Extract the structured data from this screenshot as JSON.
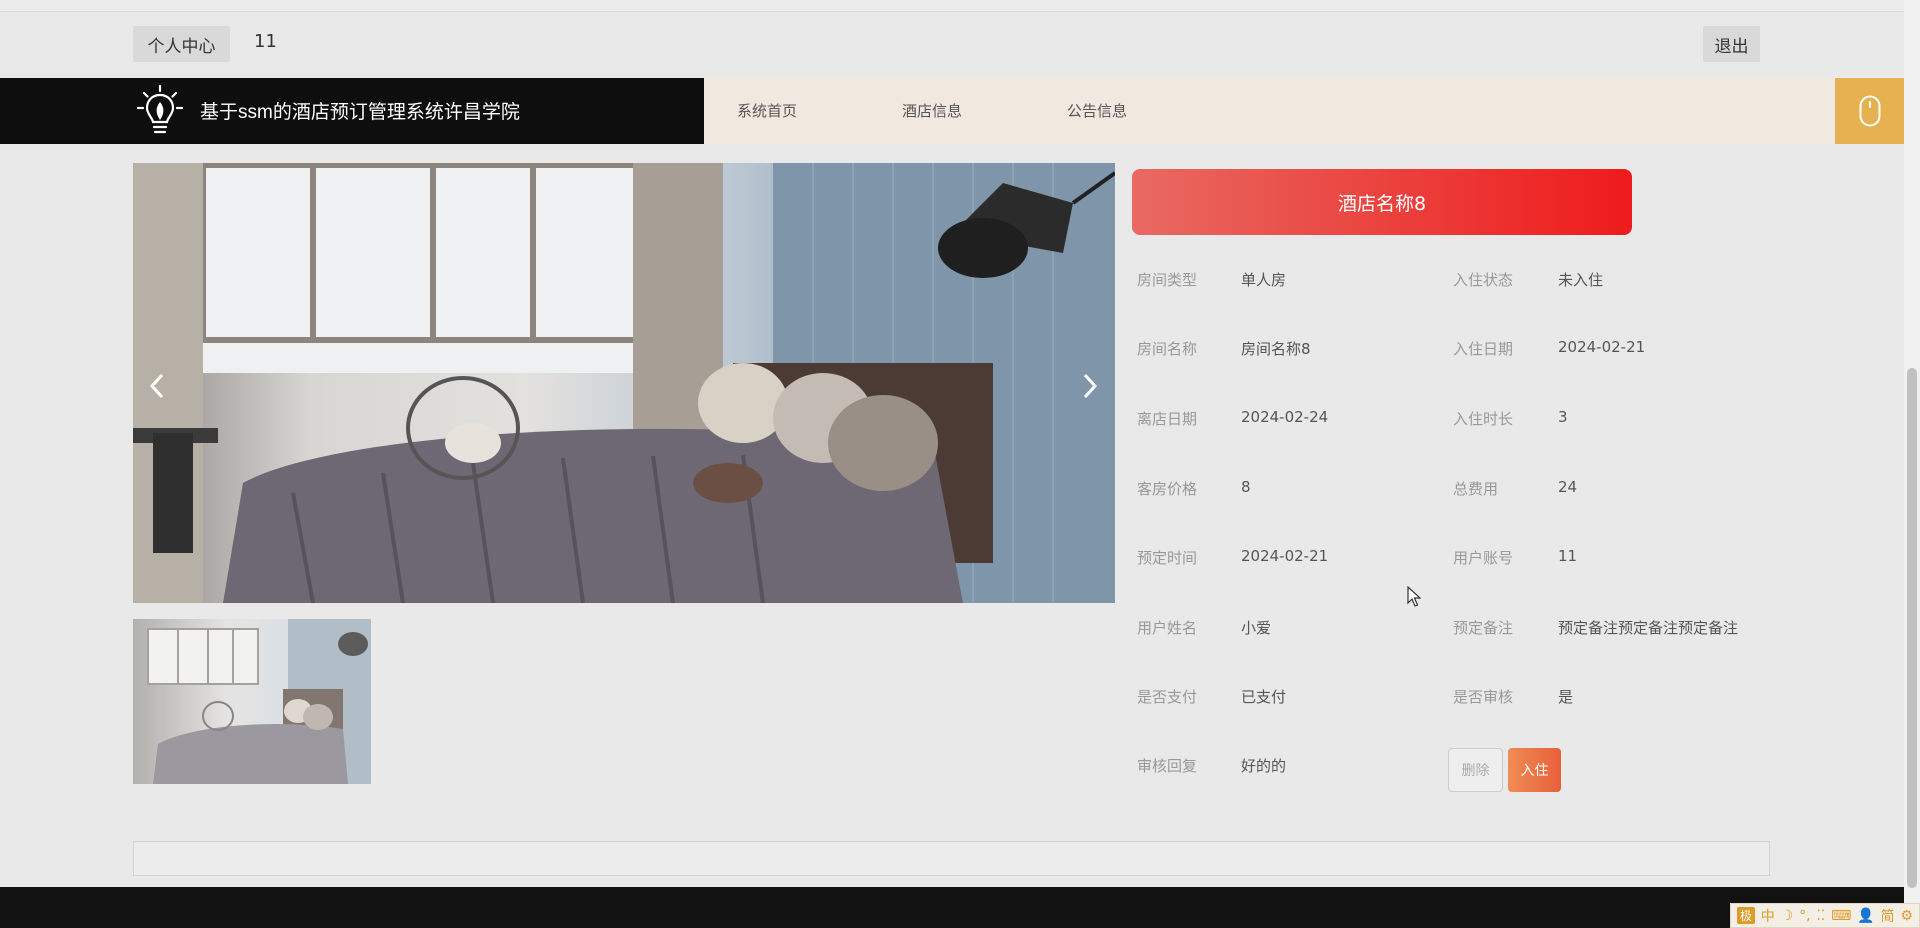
{
  "topbar": {
    "personal_center": "个人中心",
    "user_id": "11",
    "logout": "退出"
  },
  "header": {
    "title": "基于ssm的酒店预订管理系统许昌学院",
    "nav": [
      "系统首页",
      "酒店信息",
      "公告信息"
    ]
  },
  "gallery": {
    "prev_glyph": "‹",
    "next_glyph": "›"
  },
  "detail": {
    "hotel_name": "酒店名称8",
    "fields": [
      {
        "label": "房间类型",
        "value": "单人房"
      },
      {
        "label": "入住状态",
        "value": "未入住"
      },
      {
        "label": "房间名称",
        "value": "房间名称8"
      },
      {
        "label": "入住日期",
        "value": "2024-02-21"
      },
      {
        "label": "离店日期",
        "value": "2024-02-24"
      },
      {
        "label": "入住时长",
        "value": "3"
      },
      {
        "label": "客房价格",
        "value": "8"
      },
      {
        "label": "总费用",
        "value": "24"
      },
      {
        "label": "预定时间",
        "value": "2024-02-21"
      },
      {
        "label": "用户账号",
        "value": "11"
      },
      {
        "label": "用户姓名",
        "value": "小爱"
      },
      {
        "label": "预定备注",
        "value": "预定备注预定备注预定备注"
      },
      {
        "label": "是否支付",
        "value": "已支付"
      },
      {
        "label": "是否审核",
        "value": "是"
      },
      {
        "label": "审核回复",
        "value": "好的的"
      }
    ],
    "delete_label": "删除",
    "checkin_label": "入住"
  },
  "ime": {
    "logo": "极",
    "items": [
      "中",
      "☽",
      "°,",
      "⁚⁚",
      "⌨",
      "👤",
      "简",
      "⚙"
    ]
  },
  "colors": {
    "brand_bg": "#0e0e0e",
    "nav_bg": "#f1e8e0",
    "nav_accent": "#e6b150",
    "title_gradient_start": "#e86a62",
    "title_gradient_end": "#ee1b1b",
    "checkin_btn": "#e8603a"
  }
}
